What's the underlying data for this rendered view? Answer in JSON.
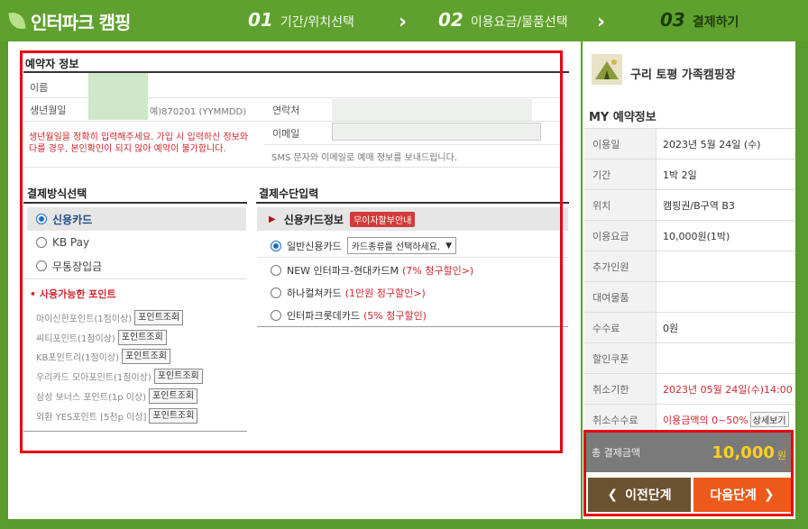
{
  "header": {
    "brand": "인터파크",
    "brand_sub": "캠핑",
    "steps": [
      {
        "num": "01",
        "label": "기간/위치선택"
      },
      {
        "num": "02",
        "label": "이용요금/물품선택"
      },
      {
        "num": "03",
        "label": "결제하기"
      }
    ],
    "chevron": "›"
  },
  "reserver": {
    "title": "예약자 정보",
    "name_label": "이름",
    "birth_label": "생년월일",
    "birth_hint": "예)870201 (YYMMDD)",
    "warning": "생년월일을 정확히 입력해주세요. 가입 시 입력하신 정보와 다를 경우, 본인확인이 되지 않아 예약이 불가합니다.",
    "contact_label": "연락처",
    "email_label": "이메일",
    "sms_note": "SMS 문자와 이메일로 예매 정보를 보내드립니다."
  },
  "payment_method": {
    "title": "결제방식선택",
    "options": [
      "신용카드",
      "KB Pay",
      "무통장입금"
    ],
    "selected": 0,
    "points_title": "사용가능한 포인트",
    "points": [
      {
        "label": "마이신한포인트(1점이상)",
        "button": "포인트조회"
      },
      {
        "label": "씨티포인트(1점이상)",
        "button": "포인트조회"
      },
      {
        "label": "KB포인트리(1점이상)",
        "button": "포인트조회"
      },
      {
        "label": "우리카드 모아포인트(1점이상)",
        "button": "포인트조회"
      },
      {
        "label": "삼성 보너스 포인트(1p 이상)",
        "button": "포인트조회"
      },
      {
        "label": "외환 YES포인트 [5천p 이상]",
        "button": "포인트조회"
      }
    ]
  },
  "card_input": {
    "title": "결제수단입력",
    "header": "신용카드정보",
    "badge": "무이자할부안내",
    "options": [
      {
        "label": "일반신용카드",
        "select": "카드종류를 선택하세요.",
        "extra": ""
      },
      {
        "label": "NEW 인터파크-현대카드M",
        "extra": "(7% 청구할인>)"
      },
      {
        "label": "하나컬쳐카드",
        "extra": "(1만원 청구할인>)"
      },
      {
        "label": "인터파크롯데카드",
        "extra": "(5% 청구할인)"
      }
    ],
    "selected": 0
  },
  "side": {
    "campsite": "구리 토평 가족캠핑장",
    "my_title": "MY 예약정보",
    "rows": [
      {
        "k": "이용일",
        "v": "2023년 5월 24일 (수)"
      },
      {
        "k": "기간",
        "v": "1박 2일"
      },
      {
        "k": "위치",
        "v": "캠핑권/B구역 B3"
      },
      {
        "k": "이용요금",
        "v": "10,000원(1박)"
      },
      {
        "k": "추가인원",
        "v": ""
      },
      {
        "k": "대여물품",
        "v": ""
      },
      {
        "k": "수수료",
        "v": "0원"
      },
      {
        "k": "할인쿠폰",
        "v": ""
      },
      {
        "k": "취소기한",
        "v": "2023년 05월 24일(수)14:00"
      },
      {
        "k": "취소수수료",
        "v": "이용금액의 0~50%",
        "button": "상세보기"
      }
    ],
    "total_label": "총 결제금액",
    "total_amount": "10,000",
    "total_unit": "원",
    "prev_label": "이전단계",
    "next_label": "다음단계"
  },
  "colors": {
    "header_bg": "#5fa12e",
    "accent_red": "#d2262e",
    "next_button": "#ee5a1c",
    "prev_button": "#6b5230",
    "total_amount": "#ffd21a"
  }
}
